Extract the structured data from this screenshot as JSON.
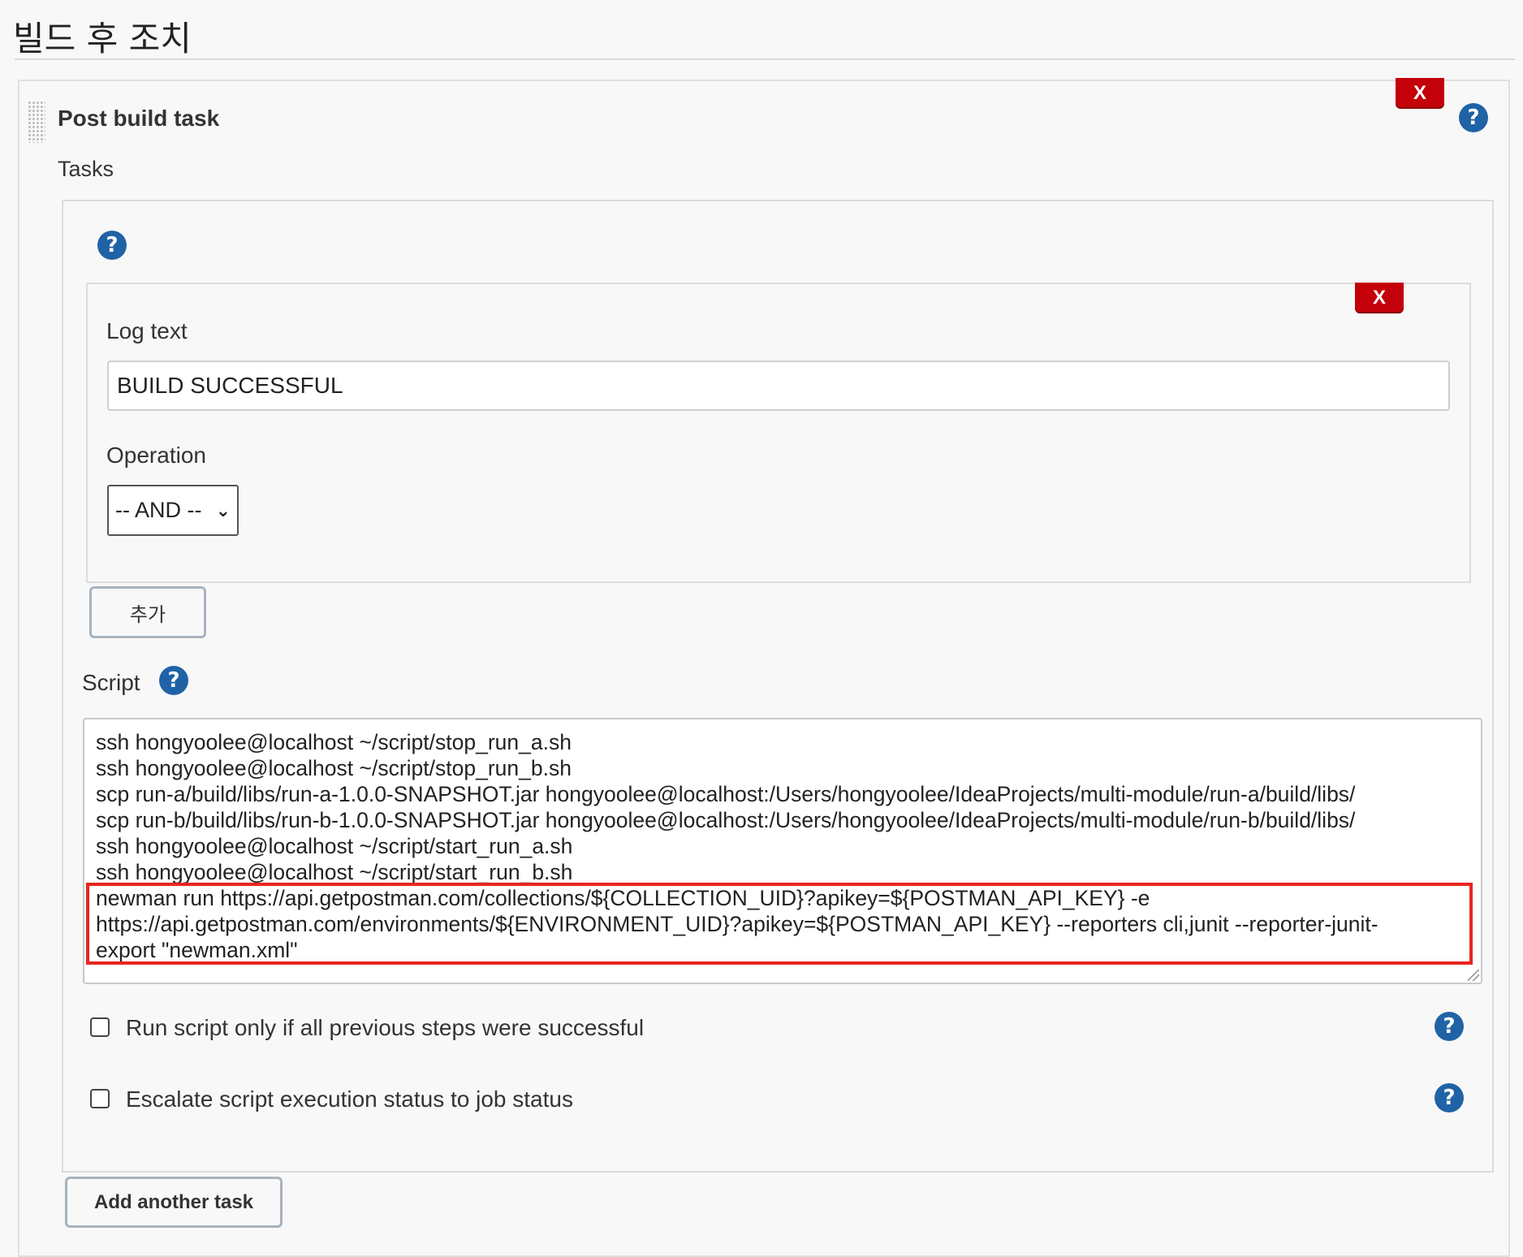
{
  "section": {
    "title": "빌드 후 조치"
  },
  "post_build_task": {
    "title": "Post build task",
    "delete_label": "X",
    "help": "?",
    "tasks_label": "Tasks",
    "task": {
      "help": "?",
      "log_entry": {
        "delete_label": "X",
        "log_text_label": "Log text",
        "log_text_value": "BUILD SUCCESSFUL",
        "operation_label": "Operation",
        "operation_value": "-- AND --"
      },
      "add_button": "추가",
      "script_label": "Script",
      "script_help": "?",
      "script_lines": [
        "ssh hongyoolee@localhost ~/script/stop_run_a.sh",
        "ssh hongyoolee@localhost ~/script/stop_run_b.sh",
        "scp run-a/build/libs/run-a-1.0.0-SNAPSHOT.jar hongyoolee@localhost:/Users/hongyoolee/IdeaProjects/multi-module/run-a/build/libs/",
        "scp run-b/build/libs/run-b-1.0.0-SNAPSHOT.jar hongyoolee@localhost:/Users/hongyoolee/IdeaProjects/multi-module/run-b/build/libs/",
        "ssh hongyoolee@localhost ~/script/start_run_a.sh",
        "ssh hongyoolee@localhost ~/script/start_run_b.sh",
        "newman run https://api.getpostman.com/collections/${COLLECTION_UID}?apikey=${POSTMAN_API_KEY} -e",
        "https://api.getpostman.com/environments/${ENVIRONMENT_UID}?apikey=${POSTMAN_API_KEY} --reporters cli,junit --reporter-junit-",
        "export \"newman.xml\""
      ],
      "run_only_if_success_label": "Run script only if all previous steps were successful",
      "run_only_if_success_checked": false,
      "escalate_label": "Escalate script execution status to job status",
      "escalate_checked": false,
      "option_help": "?"
    },
    "add_another_task": "Add another task"
  },
  "colors": {
    "delete_red": "#c4000a",
    "help_blue": "#1f63a6",
    "highlight_red": "#e8261f"
  }
}
